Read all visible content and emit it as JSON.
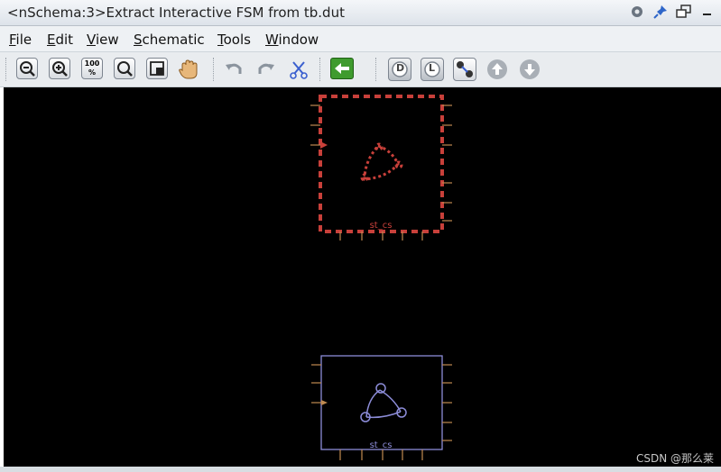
{
  "window": {
    "title": "<nSchema:3>Extract Interactive FSM from tb.dut"
  },
  "title_icons": [
    "settings-icon",
    "pin-icon",
    "restore-icon",
    "minimize-icon"
  ],
  "menu": {
    "items": [
      {
        "u": "F",
        "rest": "ile"
      },
      {
        "u": "E",
        "rest": "dit"
      },
      {
        "u": "V",
        "rest": "iew"
      },
      {
        "u": "S",
        "rest": "chematic"
      },
      {
        "u": "T",
        "rest": "ools"
      },
      {
        "u": "W",
        "rest": "indow"
      }
    ]
  },
  "toolbar": {
    "zoom_100": "100 %",
    "d_label": "D",
    "l_label": "L"
  },
  "schematic": {
    "block1_label": "st_cs",
    "block2_label": "st_cs",
    "block1_color": "#c8403a",
    "block2_color": "#8c8cd8",
    "pin_color": "#c08a50"
  },
  "watermark": "CSDN @那么莱"
}
